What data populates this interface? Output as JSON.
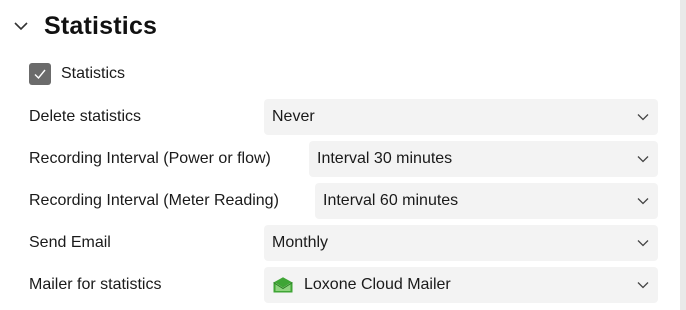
{
  "section": {
    "title": "Statistics"
  },
  "statistics_checkbox": {
    "label": "Statistics",
    "checked": true
  },
  "settings": [
    {
      "label": "Delete statistics",
      "value": "Never"
    },
    {
      "label": "Recording Interval (Power or flow)",
      "value": "Interval 30 minutes"
    },
    {
      "label": "Recording Interval (Meter Reading)",
      "value": "Interval 60 minutes"
    },
    {
      "label": "Send Email",
      "value": "Monthly"
    },
    {
      "label": "Mailer for statistics",
      "value": "Loxone Cloud Mailer",
      "icon": "mail-envelope-icon"
    }
  ],
  "colors": {
    "checkbox_fill": "#6b6b6b",
    "select_background": "#f3f3f3",
    "mail_icon_green": "#3fa535"
  }
}
